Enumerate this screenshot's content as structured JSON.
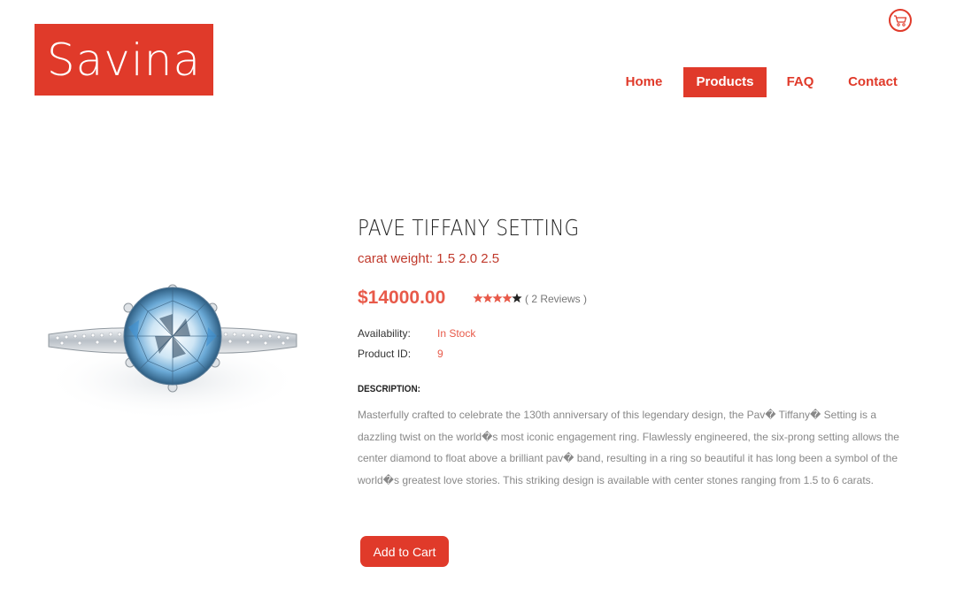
{
  "brand": {
    "logo_text": "Savina",
    "color": "#e03a2a"
  },
  "header": {
    "cart_icon": "shopping-cart-icon",
    "nav": [
      {
        "label": "Home",
        "active": false
      },
      {
        "label": "Products",
        "active": true
      },
      {
        "label": "FAQ",
        "active": false
      },
      {
        "label": "Contact",
        "active": false
      }
    ]
  },
  "product": {
    "image": "diamond-ring-image",
    "title": "PAVE TIFFANY SETTING",
    "carat_weight": "carat weight: 1.5 2.0 2.5",
    "price": "$14000.00",
    "rating": 4.5,
    "rating_max": 5,
    "reviews": "( 2 Reviews )",
    "availability_label": "Availability:",
    "availability_value": "In Stock",
    "product_id_label": "Product ID:",
    "product_id_value": "9",
    "description_heading": "DESCRIPTION:",
    "description": "Masterfully crafted to celebrate the 130th anniversary of this legendary design, the Pav� Tiffany� Setting is a dazzling twist on the world�s most iconic engagement ring. Flawlessly engineered, the six-prong setting allows the center diamond to float above a brilliant pav� band, resulting in a ring so beautiful it has long been a symbol of the world�s greatest love stories. This striking design is available with center stones ranging from 1.5 to 6 carats.",
    "add_to_cart_label": "Add to Cart"
  }
}
